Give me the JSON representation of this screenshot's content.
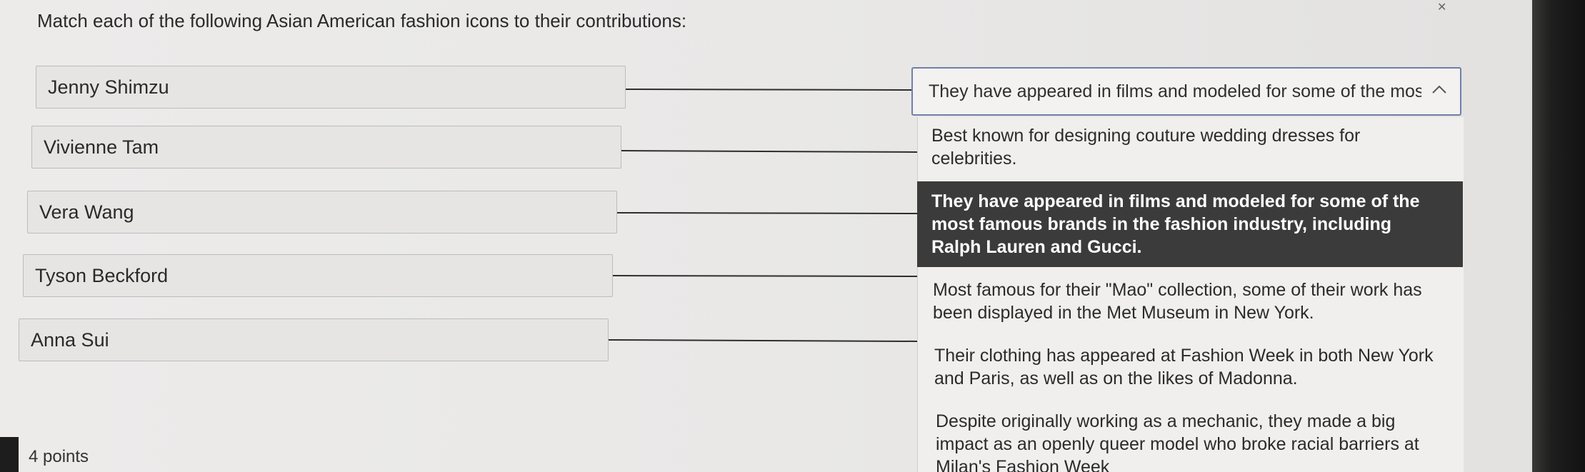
{
  "question": "Match each of the following Asian American fashion icons to their contributions:",
  "names": [
    "Jenny Shimzu",
    "Vivienne Tam",
    "Vera Wang",
    "Tyson Beckford",
    "Anna Sui"
  ],
  "dropdown": {
    "selected": "They have appeared in films and modeled for some of the mos",
    "chevron_icon": "chevron-up-icon",
    "options": [
      "Best known for designing couture wedding dresses for celebrities.",
      "They have appeared in films and modeled for some of the most famous brands in the fashion industry, including Ralph Lauren and Gucci.",
      "Most famous for their \"Mao\" collection, some of their work has been displayed in the Met Museum in New York.",
      "Their clothing has appeared at Fashion Week in both New York and Paris, as well as on the likes of Madonna.",
      "Despite originally working as a mechanic, they made a big impact as an openly queer model who broke racial barriers at Milan's Fashion Week"
    ],
    "highlighted_index": 1
  },
  "points": "4 points",
  "colors": {
    "highlight_bg": "#3b3b3b",
    "dropdown_border": "#6f7fa8",
    "connector_line": "#2e2e2e"
  }
}
